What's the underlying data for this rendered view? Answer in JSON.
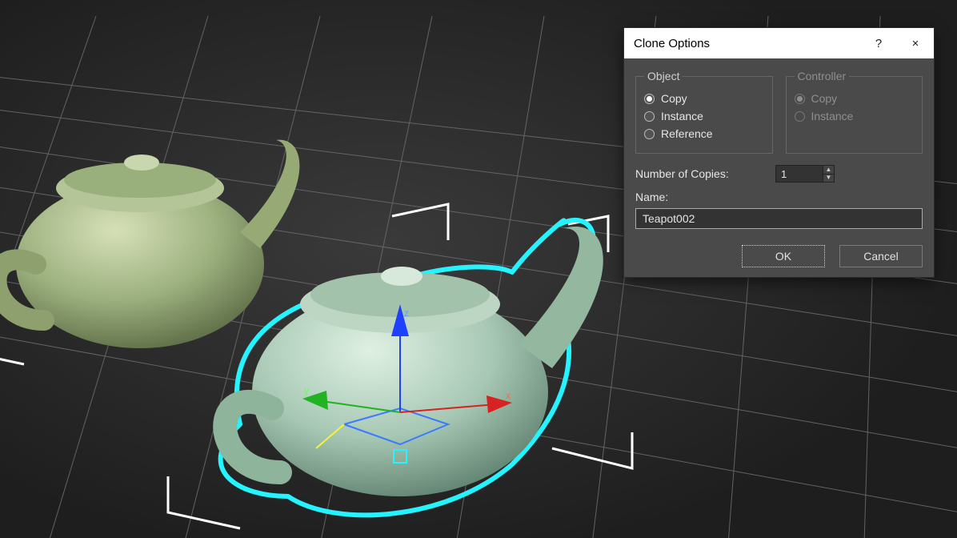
{
  "dialog": {
    "title": "Clone Options",
    "help_label": "?",
    "close_label": "×",
    "object_group": {
      "legend": "Object",
      "options": [
        {
          "label": "Copy",
          "checked": true
        },
        {
          "label": "Instance",
          "checked": false
        },
        {
          "label": "Reference",
          "checked": false
        }
      ]
    },
    "controller_group": {
      "legend": "Controller",
      "enabled": false,
      "options": [
        {
          "label": "Copy",
          "checked": true
        },
        {
          "label": "Instance",
          "checked": false
        }
      ]
    },
    "copies": {
      "label": "Number of Copies:",
      "value": "1"
    },
    "name": {
      "label": "Name:",
      "value": "Teapot002"
    },
    "buttons": {
      "ok": "OK",
      "cancel": "Cancel"
    }
  },
  "scene": {
    "objects": [
      "Teapot001",
      "Teapot002"
    ],
    "selected": "Teapot002",
    "gizmo_axes": [
      "X",
      "Y",
      "Z"
    ]
  }
}
